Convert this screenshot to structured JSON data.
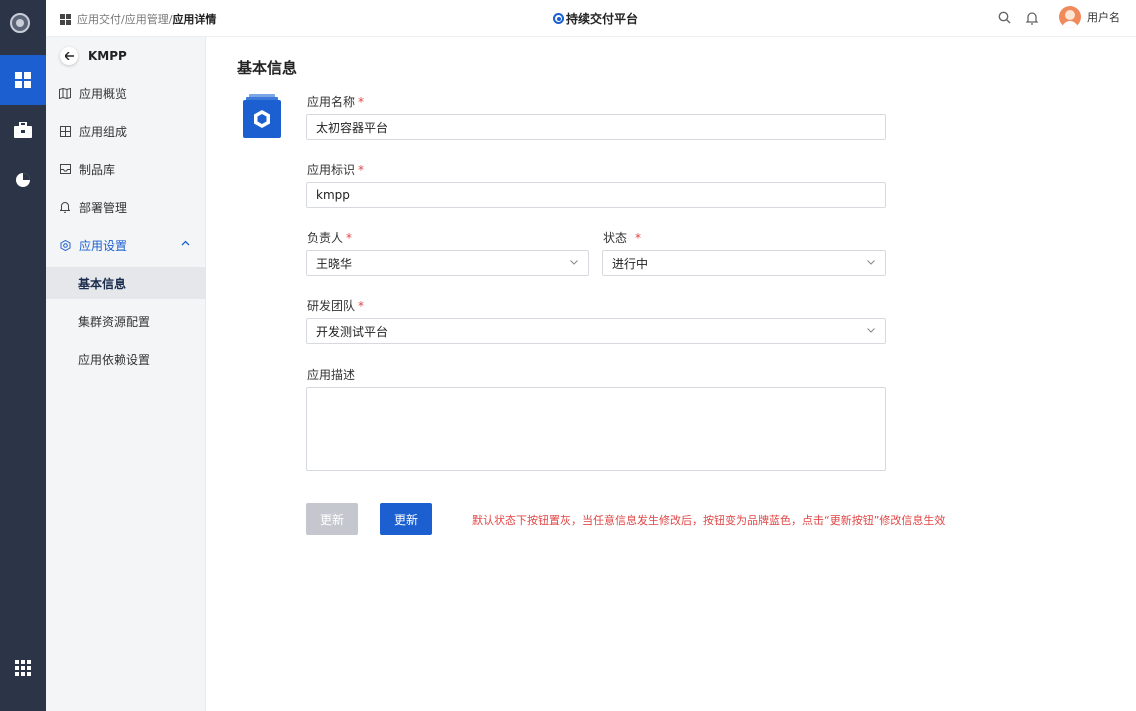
{
  "topbar": {
    "breadcrumb": [
      "应用交付",
      "应用管理",
      "应用详情"
    ],
    "breadcrumb_sep": "/",
    "brand": "持续交付平台",
    "user_name": "用户名"
  },
  "rail": {
    "icons": [
      "platform-logo",
      "grid-icon",
      "toolbox-icon",
      "pie-chart-icon",
      "apps-icon"
    ]
  },
  "sidenav": {
    "back_label": "KMPP",
    "items": [
      {
        "label": "应用概览",
        "icon": "map-icon"
      },
      {
        "label": "应用组成",
        "icon": "layout-icon"
      },
      {
        "label": "制品库",
        "icon": "inbox-icon"
      },
      {
        "label": "部署管理",
        "icon": "bell-icon"
      },
      {
        "label": "应用设置",
        "icon": "gear-icon"
      }
    ],
    "sub_items": [
      "基本信息",
      "集群资源配置",
      "应用依赖设置"
    ]
  },
  "main": {
    "title": "基本信息",
    "required_mark": "*",
    "fields": {
      "name": {
        "label": "应用名称",
        "value": "太初容器平台"
      },
      "id": {
        "label": "应用标识",
        "value": "kmpp"
      },
      "owner": {
        "label": "负责人",
        "value": "王晓华"
      },
      "status": {
        "label": "状态",
        "value": "进行中"
      },
      "team": {
        "label": "研发团队",
        "value": "开发测试平台"
      },
      "desc": {
        "label": "应用描述",
        "value": ""
      }
    },
    "buttons": {
      "disabled_label": "更新",
      "primary_label": "更新"
    },
    "note": "默认状态下按钮置灰，当任意信息发生修改后，按钮变为品牌蓝色，点击“更新按钮”修改信息生效"
  },
  "colors": {
    "brand_blue": "#1b5fd0",
    "rail_bg": "#2b3547",
    "required_red": "#e04646",
    "disabled_gray": "#c4c8ce"
  }
}
